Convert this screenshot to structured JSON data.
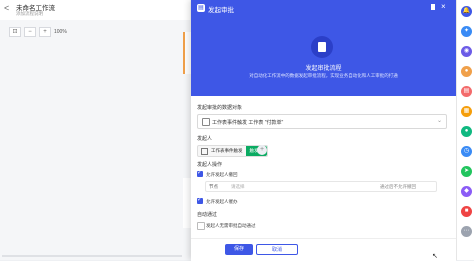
{
  "editor": {
    "back_icon": "<",
    "title": "未命名工作流",
    "subtitle": "添加流程说明",
    "zoom_minus": "−",
    "zoom_value": "100%"
  },
  "drawer": {
    "header_title": "发起审批",
    "close_icon": "×",
    "hero_name": "发起审批流程",
    "hero_desc": "对自动化工作流中的数据发起审批流程，实现业务自动化和人工审批的打通",
    "target_label": "发起审批的数据对象",
    "target_value": "工作表事件触发 工作表 \"付款单\"",
    "initiator_label": "发起人",
    "initiator_chip_text": "工作表事件触发",
    "initiator_chip_tag": "触发者",
    "ops_label": "发起人操作",
    "opt_allow_withdraw": "允许发起人撤回",
    "node_prefix": "节点",
    "node_placeholder": "请选择",
    "node_suffix": "通过后不允许撤回",
    "opt_allow_urge": "允许发起人催办",
    "auto_pass_label": "自动通过",
    "opt_auto_pass": "发起人无需审批自动通过",
    "save_label": "保存",
    "cancel_label": "取消"
  },
  "rail": {
    "icons": [
      {
        "name": "bell-icon",
        "color": "#3e57e6",
        "glyph": "🔔"
      },
      {
        "name": "ai-star-icon",
        "color": "#3a8bf5",
        "glyph": "✦"
      },
      {
        "name": "robot-icon",
        "color": "#6c5ce7",
        "glyph": "◉"
      },
      {
        "name": "user-avatar-icon",
        "color": "#f0a04a",
        "glyph": "●"
      },
      {
        "name": "building-icon",
        "color": "#f36b6b",
        "glyph": "▤"
      },
      {
        "name": "work-icon",
        "color": "#f59e0b",
        "glyph": "▦"
      },
      {
        "name": "chat-icon",
        "color": "#10b981",
        "glyph": "●"
      },
      {
        "name": "clock-icon",
        "color": "#3a8bf5",
        "glyph": "◷"
      },
      {
        "name": "send-icon",
        "color": "#22c55e",
        "glyph": "➤"
      },
      {
        "name": "shield-icon",
        "color": "#8b5cf6",
        "glyph": "◆"
      },
      {
        "name": "app-icon",
        "color": "#ef4444",
        "glyph": "■"
      },
      {
        "name": "more-icon",
        "color": "#9ca3af",
        "glyph": "⋯"
      }
    ]
  }
}
